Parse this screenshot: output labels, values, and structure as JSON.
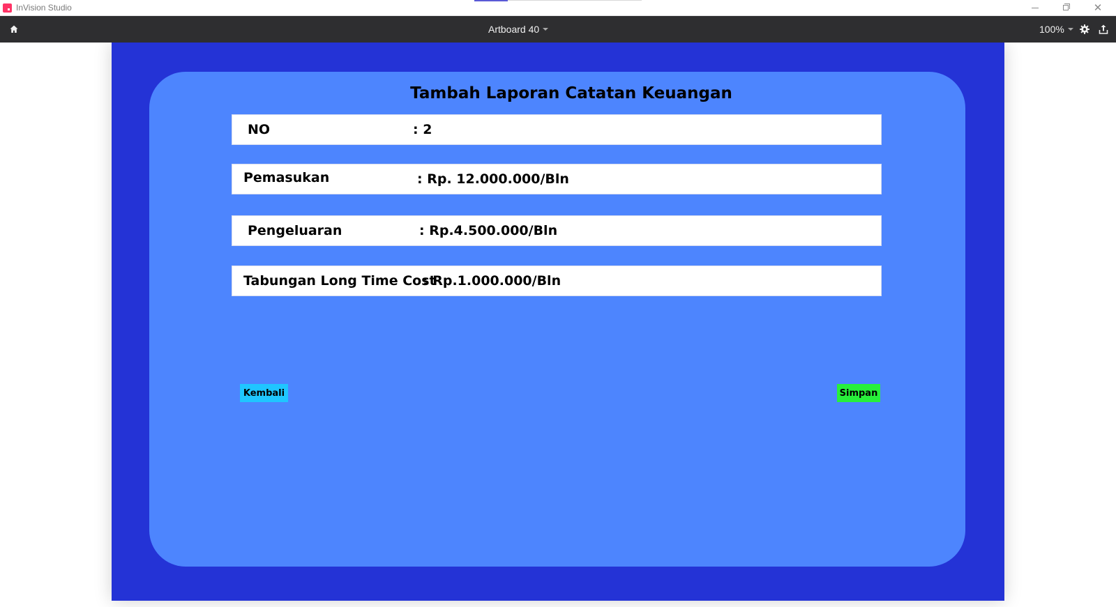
{
  "window": {
    "app_title": "InVision Studio",
    "accent_color": "#ff3366"
  },
  "toolbar": {
    "artboard_name": "Artboard 40",
    "zoom_level": "100%",
    "icons": [
      "home-icon",
      "gear-icon",
      "share-icon"
    ]
  },
  "artboard": {
    "background_color": "#2433d6",
    "panel_color": "#4d85fe",
    "title": "Tambah Laporan Catatan Keuangan",
    "rows": [
      {
        "label": "NO",
        "value": ": 2"
      },
      {
        "label": "Pemasukan",
        "value": ": Rp. 12.000.000/Bln"
      },
      {
        "label": "Pengeluaran",
        "value": ": Rp.4.500.000/Bln"
      },
      {
        "label": "Tabungan Long Time Cost",
        "value": ": Rp.1.000.000/Bln"
      }
    ],
    "buttons": {
      "back_label": "Kembali",
      "back_color": "#1fc6ff",
      "save_label": "Simpan",
      "save_color": "#27f03a"
    }
  }
}
